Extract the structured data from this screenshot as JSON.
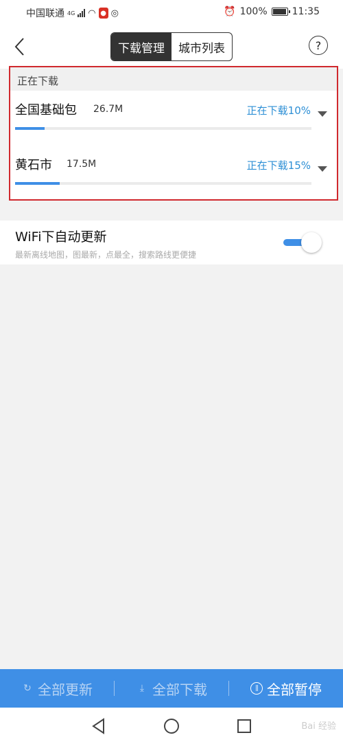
{
  "status_bar": {
    "carrier": "中国联通",
    "network": "4G",
    "battery": "100%",
    "time": "11:35"
  },
  "header": {
    "tabs": [
      {
        "label": "下载管理",
        "active": true
      },
      {
        "label": "城市列表",
        "active": false
      }
    ],
    "help": "?"
  },
  "downloading": {
    "title": "正在下载",
    "items": [
      {
        "name": "全国基础包",
        "size": "26.7M",
        "status": "正在下载10%",
        "progress": 0.1
      },
      {
        "name": "黄石市",
        "size": "17.5M",
        "status": "正在下载15%",
        "progress": 0.15
      }
    ]
  },
  "wifi": {
    "title": "WiFi下自动更新",
    "subtitle": "最新离线地图，图最新，点最全，搜索路线更便捷",
    "enabled": true
  },
  "bottom_bar": {
    "update_all": "全部更新",
    "download_all": "全部下载",
    "pause_all": "全部暂停"
  },
  "watermark": "Bai 经验",
  "colors": {
    "accent": "#3f8fe6",
    "status_text": "#2d8fd5",
    "highlight_border": "#d0282d"
  }
}
